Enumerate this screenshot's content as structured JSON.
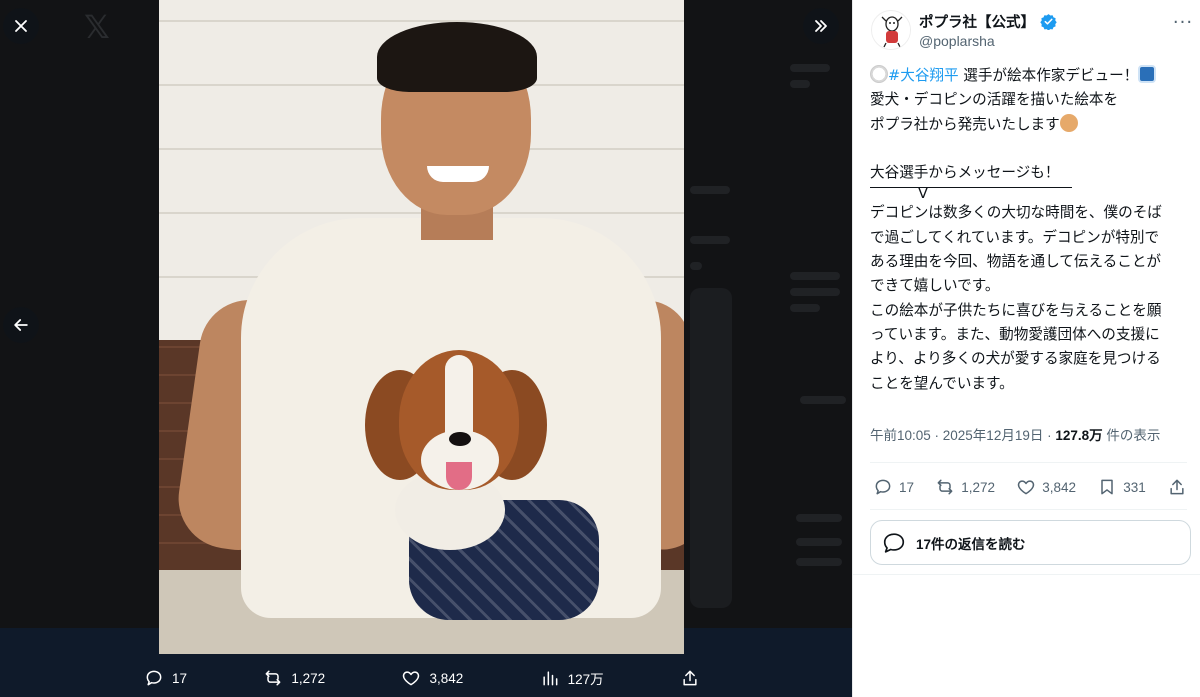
{
  "viewer": {
    "close_label": "×",
    "actions": {
      "replies": "17",
      "reposts": "1,272",
      "likes": "3,842",
      "views": "127万"
    }
  },
  "tweet": {
    "author_name": "ポプラ社【公式】",
    "author_handle": "@poplarsha",
    "more_label": "···",
    "lines": {
      "l1_hashtag": "#大谷翔平",
      "l1_rest": " 選手が絵本作家デビュー！",
      "l2": "愛犬・デコピンの活躍を描いた絵本を",
      "l3": "ポプラ社から発売いたします",
      "l5": "大谷選手からメッセージも！",
      "l5b": "V",
      "l6": "デコピンは数多くの大切な時間を、僕のそば",
      "l7": "で過ごしてくれています。デコピンが特別で",
      "l8": "ある理由を今回、物語を通して伝えることが",
      "l9": "できて嬉しいです。",
      "l10": "この絵本が子供たちに喜びを与えることを願",
      "l11": "っています。また、動物愛護団体への支援に",
      "l12": "より、より多くの犬が愛する家庭を見つける",
      "l13": "ことを望んでいます。"
    },
    "meta": {
      "time": "午前10:05 · 2025年12月19日 · ",
      "views_count": "127.8万",
      "views_suffix": " 件の表示"
    },
    "actions": {
      "replies": "17",
      "reposts": "1,272",
      "likes": "3,842",
      "bookmarks": "331"
    },
    "read_replies_label": "17件の返信を読む"
  },
  "colors": {
    "hashtag": "#1d9bf0",
    "verified": "#1d9bf0",
    "text": "#0f1419",
    "muted": "#536471"
  }
}
